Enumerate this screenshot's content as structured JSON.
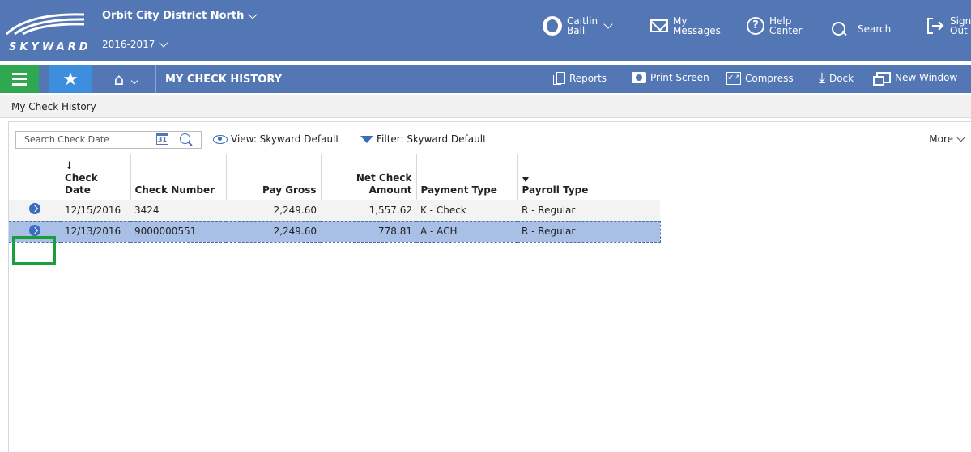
{
  "header": {
    "logo_text": "SKYWARD",
    "district": "Orbit City District North",
    "school_year": "2016-2017",
    "user_first": "Caitlin",
    "user_last": "Ball",
    "messages_line1": "My",
    "messages_line2": "Messages",
    "help_line1": "Help",
    "help_line2": "Center",
    "search_label": "Search",
    "signout_line1": "Sign",
    "signout_line2": "Out"
  },
  "navbar": {
    "page_title": "MY CHECK HISTORY",
    "actions": {
      "reports": "Reports",
      "print_screen": "Print Screen",
      "compress": "Compress",
      "dock": "Dock",
      "new_window": "New Window"
    }
  },
  "breadcrumb": "My Check History",
  "toolbar": {
    "search_placeholder": "Search Check Date",
    "calendar_day": "31",
    "view_label": "View: Skyward Default",
    "filter_label": "Filter: Skyward Default",
    "more_label": "More"
  },
  "table": {
    "columns": {
      "check_date": "Check Date",
      "check_number": "Check Number",
      "pay_gross": "Pay Gross",
      "net_check_1": "Net Check",
      "net_check_2": "Amount",
      "payment_type": "Payment Type",
      "payroll_type": "Payroll Type"
    },
    "rows": [
      {
        "check_date": "12/15/2016",
        "check_number": "3424",
        "pay_gross": "2,249.60",
        "net_check_amount": "1,557.62",
        "payment_type": "K - Check",
        "payroll_type": "R - Regular"
      },
      {
        "check_date": "12/13/2016",
        "check_number": "9000000551",
        "pay_gross": "2,249.60",
        "net_check_amount": "778.81",
        "payment_type": "A - ACH",
        "payroll_type": "R - Regular"
      }
    ]
  },
  "colors": {
    "header_blue": "#5376b4",
    "menu_green": "#2fa84f",
    "favorites_blue": "#3d8edc",
    "selected_row": "#a8bfe6",
    "highlight_green": "#1a9d3d"
  }
}
